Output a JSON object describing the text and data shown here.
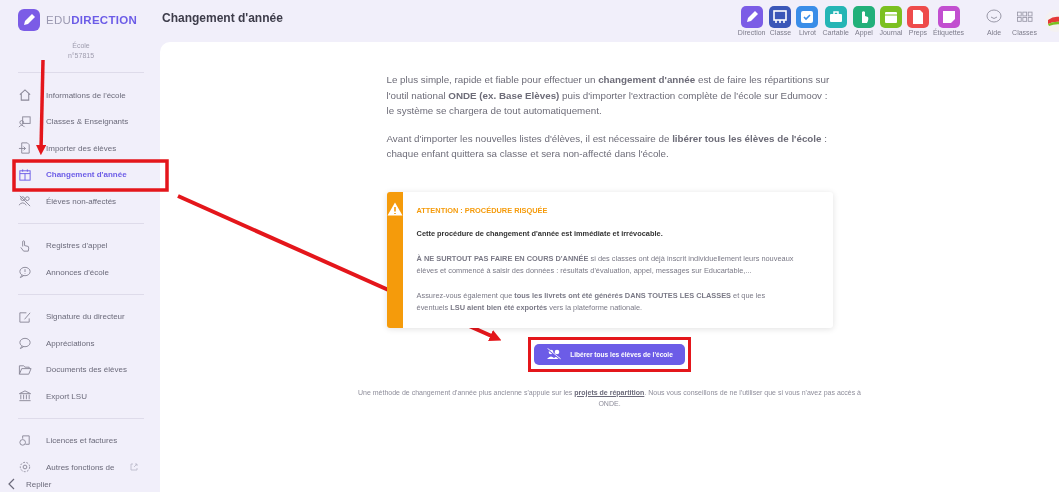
{
  "brand": {
    "prefix": "EDU",
    "name": "DIRECTION"
  },
  "school": {
    "label": "École",
    "number": "n°57815"
  },
  "page_title": "Changement d'année",
  "sidebar": {
    "groups": [
      [
        {
          "label": "Informations de l'école",
          "selected": false
        },
        {
          "label": "Classes & Enseignants",
          "selected": false
        },
        {
          "label": "Importer des élèves",
          "selected": false
        },
        {
          "label": "Changement d'année",
          "selected": true
        },
        {
          "label": "Élèves non-affectés",
          "selected": false
        }
      ],
      [
        {
          "label": "Registres d'appel",
          "selected": false
        },
        {
          "label": "Annonces d'école",
          "selected": false
        }
      ],
      [
        {
          "label": "Signature du directeur",
          "selected": false
        },
        {
          "label": "Appréciations",
          "selected": false
        },
        {
          "label": "Documents des élèves",
          "selected": false
        },
        {
          "label": "Export LSU",
          "selected": false
        }
      ],
      [
        {
          "label": "Licences et factures",
          "selected": false
        },
        {
          "label": "Autres fonctions de",
          "selected": false
        }
      ]
    ],
    "collapse": "Replier"
  },
  "apps": [
    {
      "label": "Direction",
      "color": "#7b5ce6"
    },
    {
      "label": "Classe",
      "color": "#3b57b8"
    },
    {
      "label": "Livrot",
      "color": "#3a8de8"
    },
    {
      "label": "Cartable",
      "color": "#25b5b5"
    },
    {
      "label": "Appel",
      "color": "#22b07a"
    },
    {
      "label": "Journal",
      "color": "#7cc021"
    },
    {
      "label": "Preps",
      "color": "#ee4b4b"
    },
    {
      "label": "Étiquettes",
      "color": "#c24fd0"
    }
  ],
  "tools": [
    "Aide",
    "Classes"
  ],
  "intro": [
    "Le plus simple, rapide et fiable pour effectuer un **changement d'année** est de faire les répartitions sur l'outil national **ONDE (ex. Base Elèves)** puis d'importer l'extraction complète de l'école sur Edumoov : le système se chargera de tout automatiquement.",
    "Avant d'importer les nouvelles listes d'élèves, il est nécessaire de **libérer tous les élèves de l'école** : chaque enfant quittera sa classe et sera non-affecté dans l'école."
  ],
  "warning": {
    "title": "ATTENTION : PROCÉDURE RISQUÉE",
    "paragraphs": [
      {
        "kind": "lead",
        "text": "Cette procédure de changement d'année est immédiate et irrévocable."
      },
      {
        "kind": "alert",
        "text": "**À NE SURTOUT PAS FAIRE EN COURS D'ANNÉE** si des classes ont déjà inscrit individuellement leurs nouveaux élèves et commencé à saisir des données : résultats d'évaluation, appel, messages sur Educartable,..."
      },
      {
        "kind": "note",
        "text": "Assurez-vous également que **tous les livrets ont été générés DANS TOUTES LES CLASSES** et que les éventuels **LSU aient bien été exportés** vers la plateforme nationale."
      }
    ]
  },
  "action_button": "Libérer tous les élèves de l'école",
  "footer": {
    "before": "Une méthode de changement d'année plus ancienne s'appuie sur les ",
    "link": "projets de répartition",
    "after": ". Nous vous conseillons de ne l'utiliser que si vous n'avez pas accès à ONDE."
  }
}
